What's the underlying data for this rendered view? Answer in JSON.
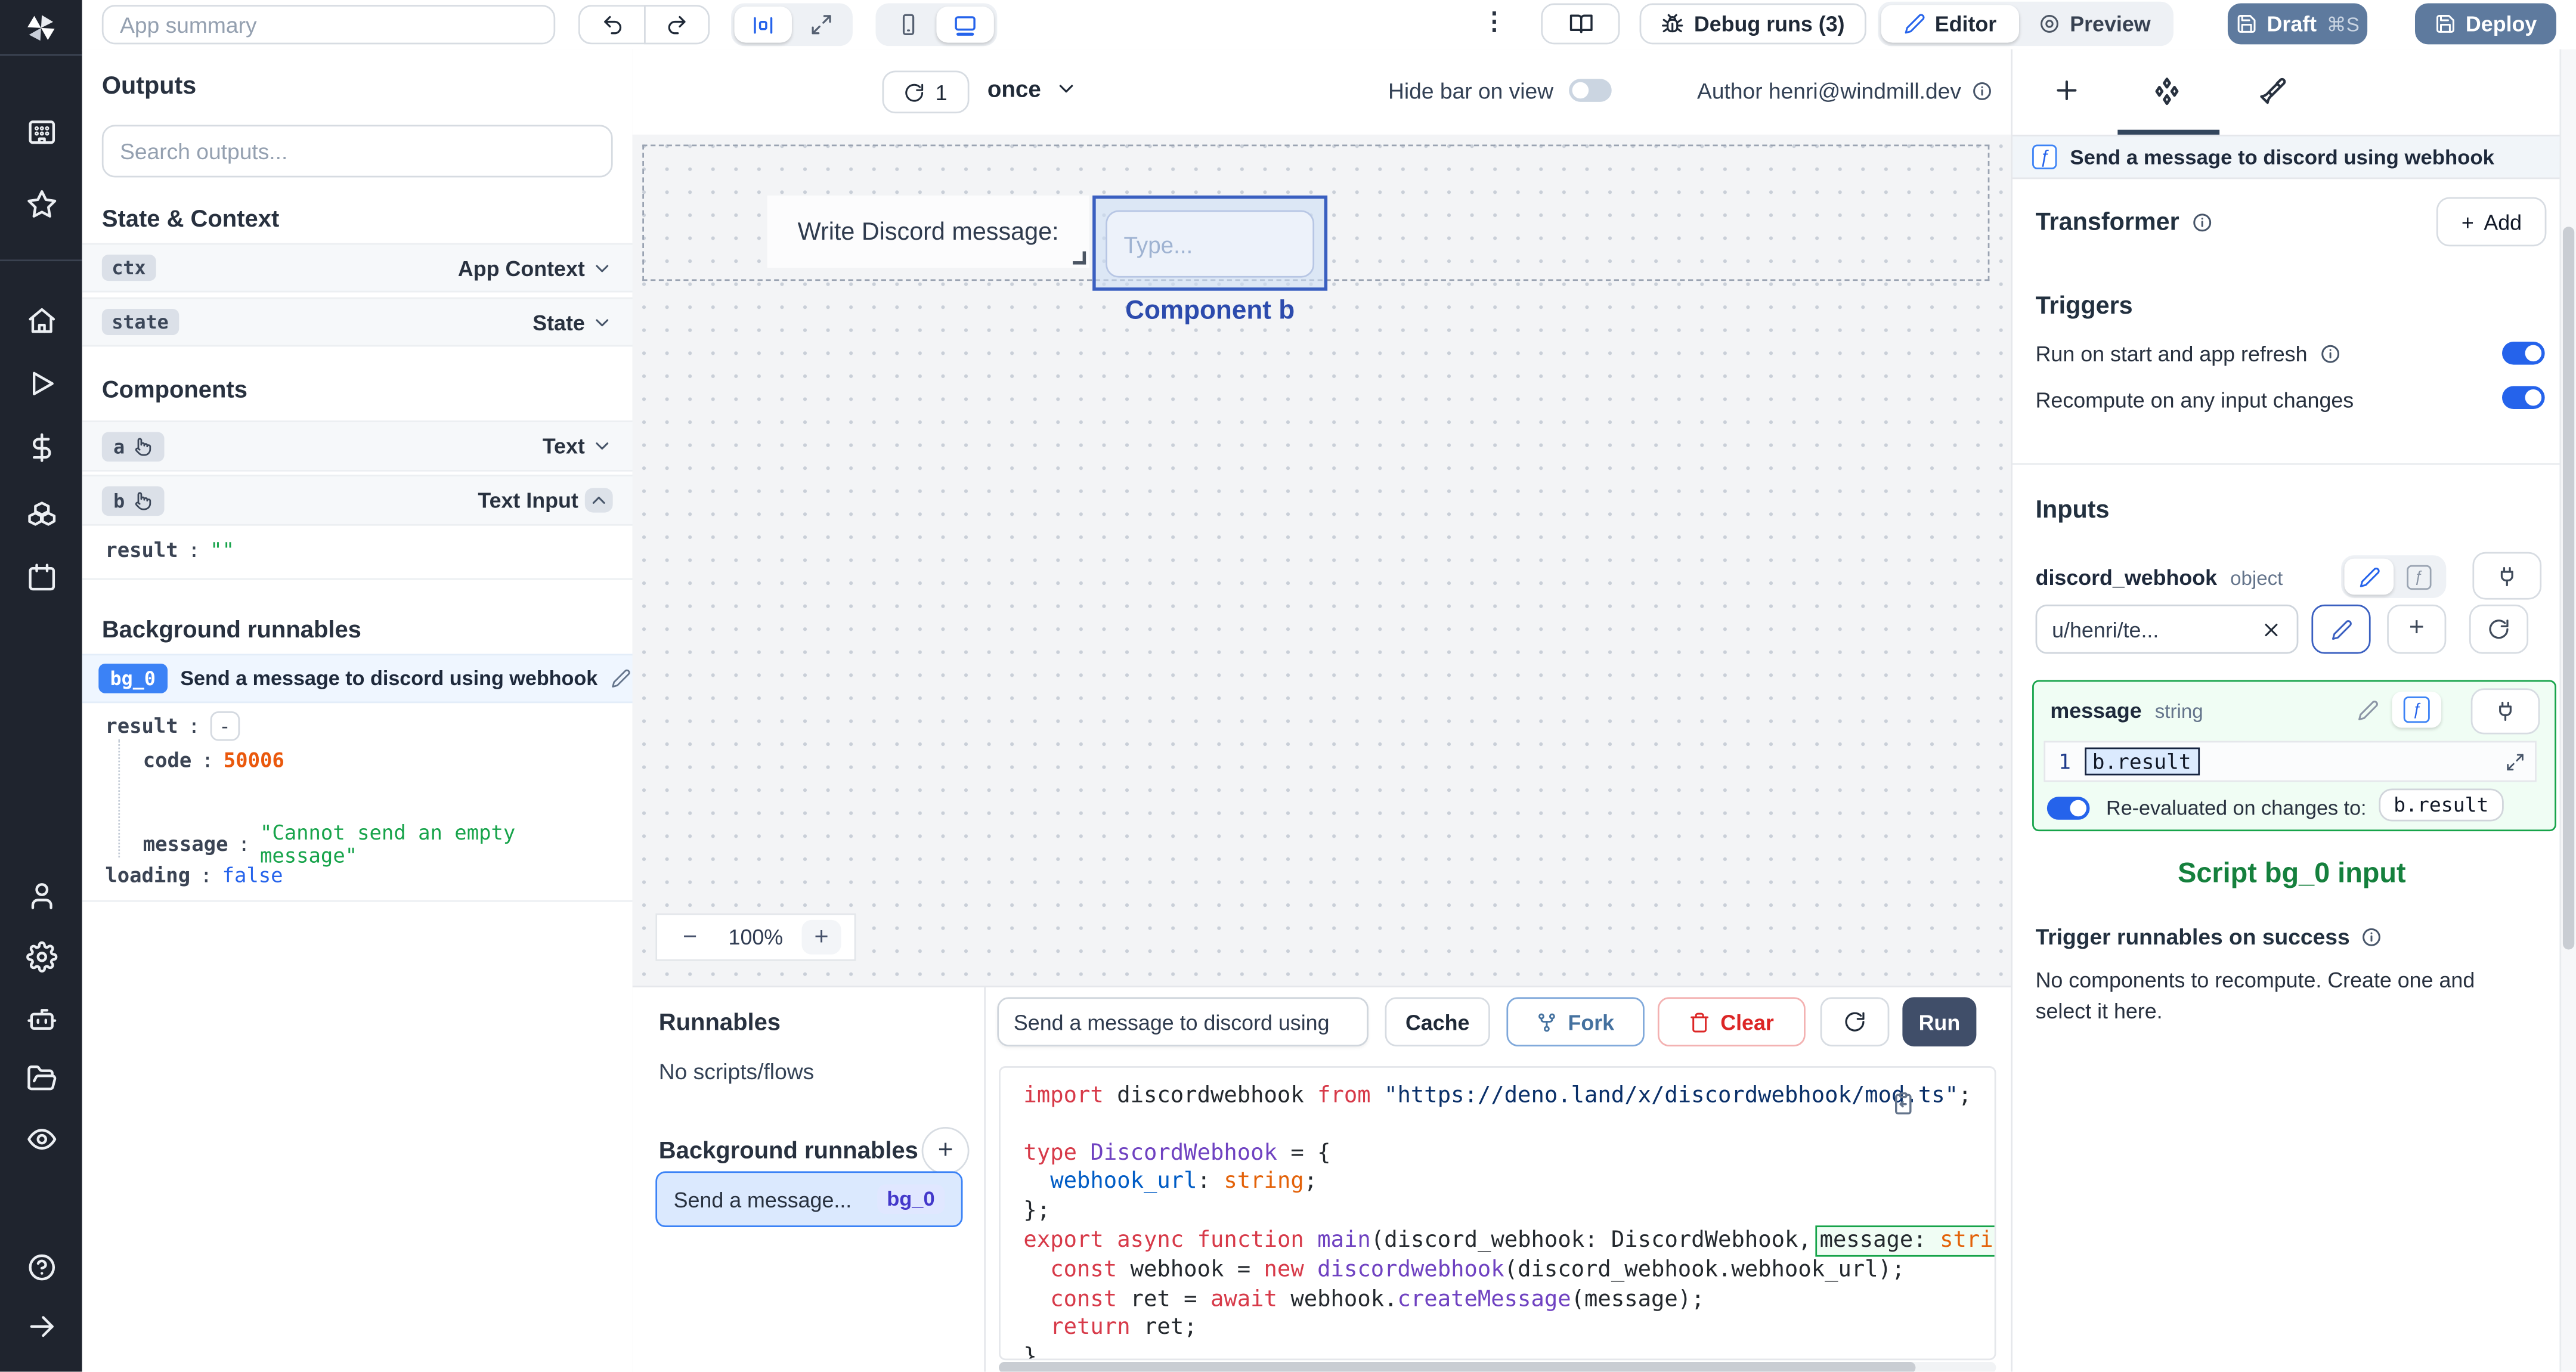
{
  "topbar": {
    "app_summary_placeholder": "App summary",
    "kebab_icon": "⋮",
    "debug_runs": "Debug runs (3)",
    "editor": "Editor",
    "preview": "Preview",
    "draft": "Draft",
    "draft_shortcut": "⌘S",
    "deploy": "Deploy"
  },
  "outputs": {
    "title": "Outputs",
    "search_placeholder": "Search outputs...",
    "state_context": "State & Context",
    "ctx_badge": "ctx",
    "ctx_type": "App Context",
    "state_badge": "state",
    "state_type": "State",
    "components_title": "Components",
    "comp_a_badge": "a",
    "comp_a_type": "Text",
    "comp_b_badge": "b",
    "comp_b_type": "Text Input",
    "result_key": "result",
    "colon": ":",
    "result_value": "\"\"",
    "background_title": "Background runnables",
    "bg0_badge": "bg_0",
    "bg0_title": "Send a message to discord using webhook",
    "bg0_result_key": "result",
    "collapse_glyph": "-",
    "code_key": "code",
    "code_value": "50006",
    "message_key": "message",
    "message_value": "\"Cannot send an empty message\"",
    "loading_key": "loading",
    "loading_value": "false"
  },
  "canvas": {
    "refresh_count": "1",
    "mode": "once",
    "hide_bar_label": "Hide bar on view",
    "author": "Author henri@windmill.dev",
    "text_component": "Write Discord message:",
    "input_placeholder": "Type...",
    "selected_label": "Component b",
    "zoom_out": "−",
    "zoom_level": "100%",
    "zoom_in": "+"
  },
  "runnables": {
    "title": "Runnables",
    "empty": "No scripts/flows",
    "background_title": "Background runnables",
    "add_glyph": "+",
    "card_title": "Send a message...",
    "card_badge": "bg_0"
  },
  "editor": {
    "name_value": "Send a message to discord using",
    "cache": "Cache",
    "fork": "Fork",
    "clear": "Clear",
    "run": "Run",
    "code_lines": [
      [
        {
          "c": "k",
          "t": "import"
        },
        {
          "c": "d",
          "t": " discordwebhook "
        },
        {
          "c": "k",
          "t": "from"
        },
        {
          "c": "d",
          "t": " "
        },
        {
          "c": "s",
          "t": "\"https://deno.land/x/discordwebhook/mod.ts\""
        },
        {
          "c": "d",
          "t": ";"
        }
      ],
      [],
      [
        {
          "c": "k",
          "t": "type"
        },
        {
          "c": "d",
          "t": " "
        },
        {
          "c": "t",
          "t": "DiscordWebhook"
        },
        {
          "c": "d",
          "t": " = {"
        }
      ],
      [
        {
          "c": "d",
          "t": "  "
        },
        {
          "c": "p",
          "t": "webhook_url"
        },
        {
          "c": "d",
          "t": ": "
        },
        {
          "c": "o",
          "t": "string"
        },
        {
          "c": "d",
          "t": ";"
        }
      ],
      [
        {
          "c": "d",
          "t": "};"
        }
      ],
      [
        {
          "c": "k",
          "t": "export"
        },
        {
          "c": "d",
          "t": " "
        },
        {
          "c": "k",
          "t": "async"
        },
        {
          "c": "d",
          "t": " "
        },
        {
          "c": "k",
          "t": "function"
        },
        {
          "c": "d",
          "t": " "
        },
        {
          "c": "t",
          "t": "main"
        },
        {
          "c": "d",
          "t": "(discord_webhook: DiscordWebhook,"
        },
        {
          "c": "box",
          "sub": [
            {
              "c": "d",
              "t": "message: "
            },
            {
              "c": "o",
              "t": "string"
            }
          ]
        }
      ],
      [
        {
          "c": "d",
          "t": "  "
        },
        {
          "c": "k",
          "t": "const"
        },
        {
          "c": "d",
          "t": " webhook = "
        },
        {
          "c": "k",
          "t": "new"
        },
        {
          "c": "d",
          "t": " "
        },
        {
          "c": "t",
          "t": "discordwebhook"
        },
        {
          "c": "d",
          "t": "(discord_webhook.webhook_url);"
        }
      ],
      [
        {
          "c": "d",
          "t": "  "
        },
        {
          "c": "k",
          "t": "const"
        },
        {
          "c": "d",
          "t": " ret = "
        },
        {
          "c": "k",
          "t": "await"
        },
        {
          "c": "d",
          "t": " webhook."
        },
        {
          "c": "t",
          "t": "createMessage"
        },
        {
          "c": "d",
          "t": "(message);"
        }
      ],
      [
        {
          "c": "d",
          "t": "  "
        },
        {
          "c": "k",
          "t": "return"
        },
        {
          "c": "d",
          "t": " ret;"
        }
      ],
      [
        {
          "c": "d",
          "t": "}"
        }
      ]
    ]
  },
  "panel": {
    "title": "Send a message to discord using webhook",
    "f_glyph": "ƒ",
    "transformer": "Transformer",
    "add": "Add",
    "add_glyph": "+",
    "triggers": "Triggers",
    "run_on_start": "Run on start and app refresh",
    "recompute": "Recompute on any input changes",
    "inputs": "Inputs",
    "dw_name": "discord_webhook",
    "dw_type": "object",
    "dw_value": "u/henri/te...",
    "msg_name": "message",
    "msg_type": "string",
    "line_no": "1",
    "expr": "b.result",
    "reeval": "Re-evaluated on changes to:",
    "reeval_chip": "b.result",
    "annotation": "Script bg_0 input",
    "on_success": "Trigger runnables on success",
    "on_success_body": "No components to recompute. Create one and select it here."
  },
  "colors": {
    "accent_blue": "#2563eb",
    "badge_blue": "#3b82f6",
    "success_green": "#16a34a",
    "annotation_green": "#15803d",
    "error_orange": "#ea580c",
    "draft_deploy_button": "#5e7a9e",
    "run_button": "#404e69",
    "rail_background": "#1f242e"
  }
}
